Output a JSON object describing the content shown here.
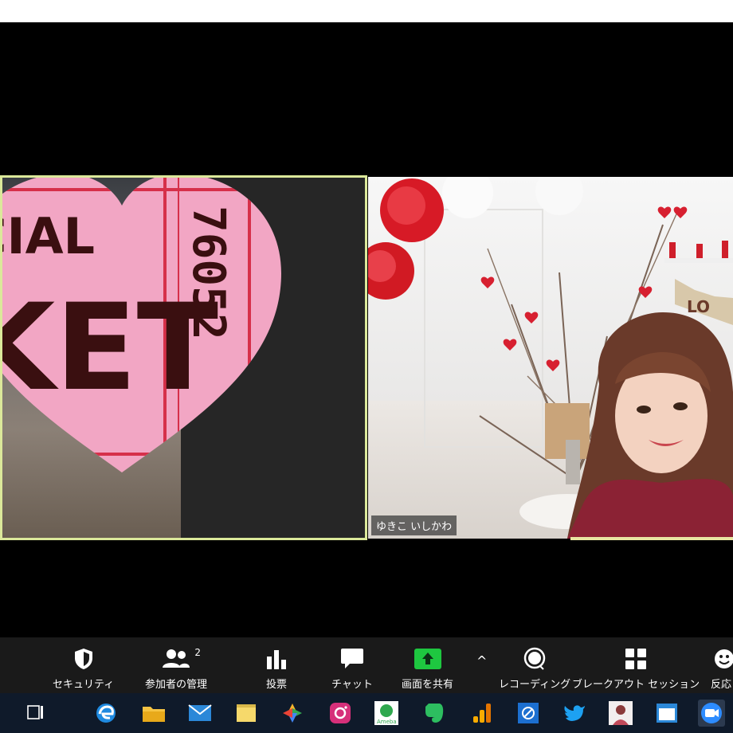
{
  "left_tile": {
    "ticket_text_1": "CIAL",
    "ticket_text_2": "KET",
    "ticket_number": "76052"
  },
  "right_tile": {
    "participant_name": "ゆきこ いしかわ",
    "banner_text": "LO"
  },
  "toolbar": {
    "security_label": "セキュリティ",
    "participants_label": "参加者の管理",
    "participants_count": "2",
    "polls_label": "投票",
    "chat_label": "チャット",
    "share_label": "画面を共有",
    "record_label": "レコーディング",
    "breakout_label": "ブレークアウト セッション",
    "reactions_label": "反応",
    "colors": {
      "toolbar_bg": "#1a1a1a",
      "share_green": "#1ec740"
    }
  },
  "taskbar": {
    "icons": [
      "task-view-icon",
      "edge-icon",
      "file-explorer-icon",
      "mail-icon",
      "sticky-notes-icon",
      "photos-icon",
      "instagram-icon",
      "ameba-icon",
      "evernote-icon",
      "analytics-icon",
      "app-icon",
      "twitter-icon",
      "profile-photo-icon",
      "window-icon",
      "zoom-icon"
    ],
    "ameba_text": "Ameba"
  }
}
